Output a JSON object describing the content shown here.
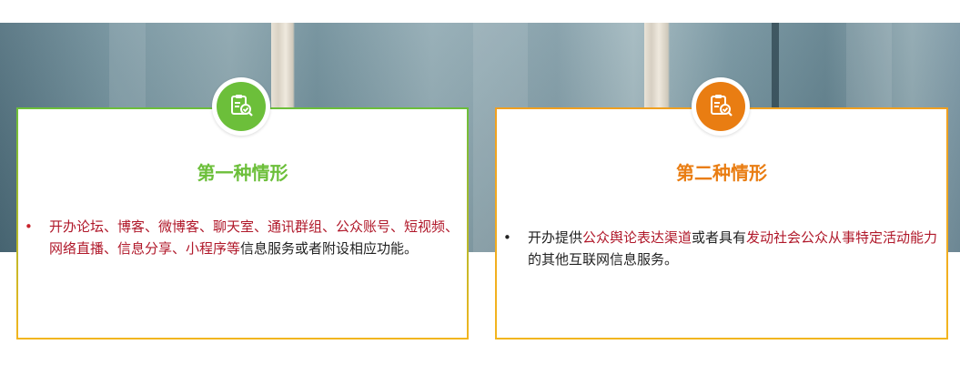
{
  "cards": [
    {
      "title": "第一种情形",
      "icon": "document-check-icon",
      "accent": "#6cbf3a",
      "bullet": "•",
      "text_red": "开办论坛、博客、微博客、聊天室、通讯群组、公众账号、短视频、网络直播、信息分享、小程序等",
      "text_plain": "信息服务或者附设相应功能。"
    },
    {
      "title": "第二种情形",
      "icon": "document-check-icon",
      "accent": "#e97d12",
      "bullet": "•",
      "text_1": "开办提供",
      "text_red_1": "公众舆论表达渠道",
      "text_2": "或者具有",
      "text_red_2": "发动社会公众从事特定活动能力",
      "text_3": "的其他互联网信息服务。"
    }
  ]
}
